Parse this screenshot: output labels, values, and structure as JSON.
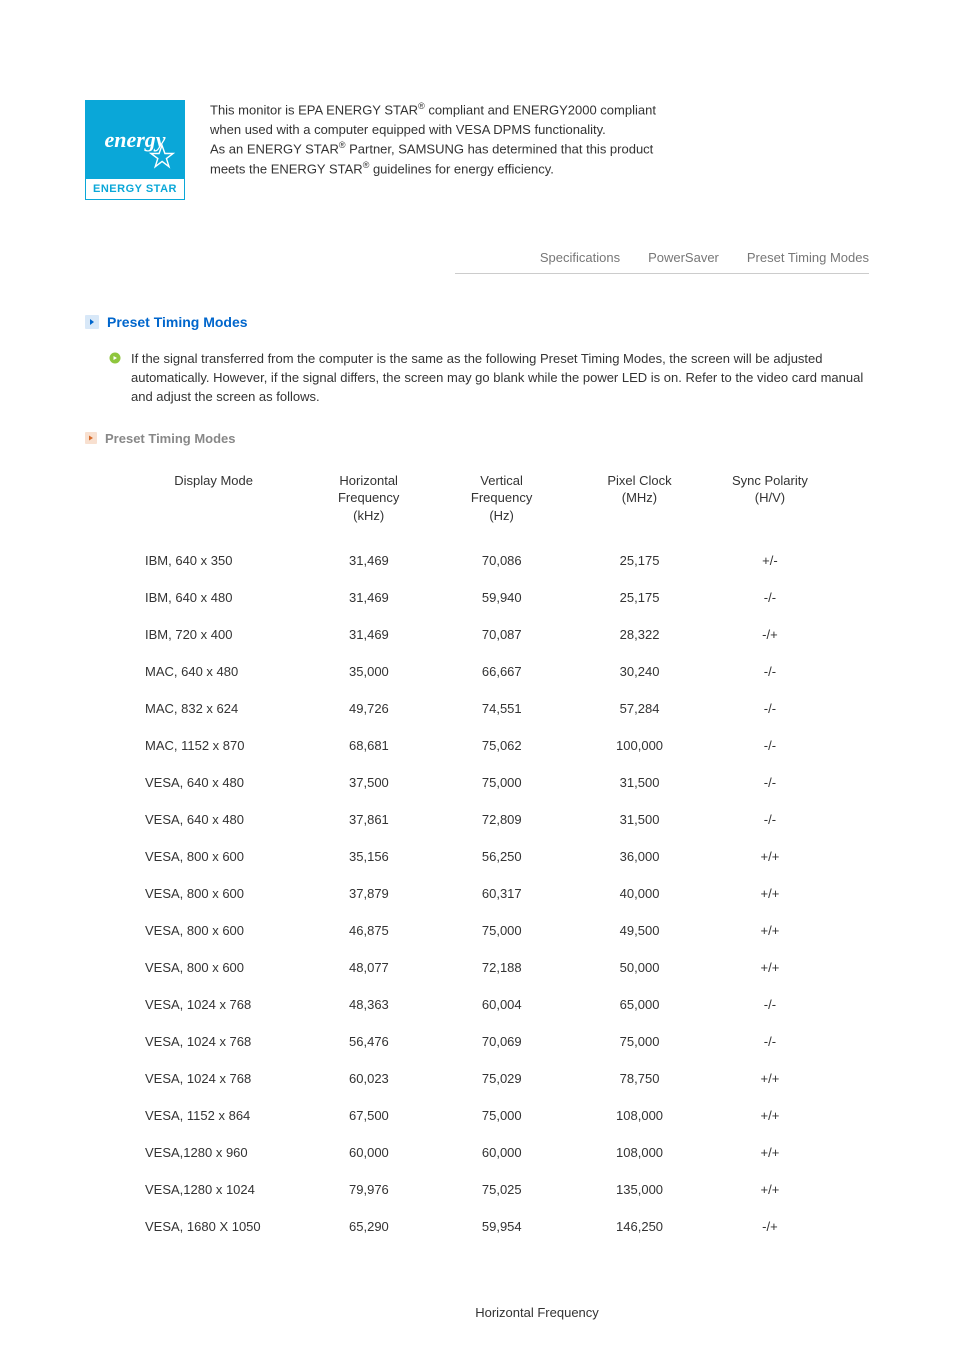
{
  "energyStar": {
    "logoScript": "energy",
    "logoBottom": "ENERGY STAR",
    "para1a": "This monitor is EPA ENERGY STAR",
    "para1b": " compliant and ENERGY2000 compliant when used with a computer equipped with VESA DPMS functionality.",
    "para2a": "As an ENERGY STAR",
    "para2b": " Partner, SAMSUNG has determined that this product meets the ENERGY STAR",
    "para2c": " guidelines for energy efficiency.",
    "reg": "®"
  },
  "tabs": {
    "specifications": "Specifications",
    "powersaver": "PowerSaver",
    "preset": "Preset Timing Modes"
  },
  "section": {
    "title": "Preset Timing Modes",
    "intro": "If the signal transferred from the computer is the same as the following Preset Timing Modes, the screen will be adjusted automatically. However, if the signal differs, the screen may go blank while the power LED is on. Refer to the video card manual and adjust the screen as follows.",
    "subsection": "Preset Timing Modes"
  },
  "table": {
    "headers": {
      "displayMode": "Display Mode",
      "horizontal": "Horizontal\nFrequency\n(kHz)",
      "vertical": "Vertical\nFrequency\n(Hz)",
      "pixelClock": "Pixel Clock\n(MHz)",
      "syncPolarity": "Sync Polarity\n(H/V)"
    },
    "rows": [
      {
        "mode": "IBM, 640 x 350",
        "h": "31,469",
        "v": "70,086",
        "p": "25,175",
        "s": "+/-"
      },
      {
        "mode": "IBM, 640 x 480",
        "h": "31,469",
        "v": "59,940",
        "p": "25,175",
        "s": "-/-"
      },
      {
        "mode": "IBM, 720 x 400",
        "h": "31,469",
        "v": "70,087",
        "p": "28,322",
        "s": "-/+"
      },
      {
        "mode": "MAC, 640 x 480",
        "h": "35,000",
        "v": "66,667",
        "p": "30,240",
        "s": "-/-"
      },
      {
        "mode": "MAC, 832 x 624",
        "h": "49,726",
        "v": "74,551",
        "p": "57,284",
        "s": "-/-"
      },
      {
        "mode": "MAC, 1152 x 870",
        "h": "68,681",
        "v": "75,062",
        "p": "100,000",
        "s": "-/-"
      },
      {
        "mode": "VESA, 640 x 480",
        "h": "37,500",
        "v": "75,000",
        "p": "31,500",
        "s": "-/-"
      },
      {
        "mode": "VESA, 640 x 480",
        "h": "37,861",
        "v": "72,809",
        "p": "31,500",
        "s": "-/-"
      },
      {
        "mode": "VESA, 800 x 600",
        "h": "35,156",
        "v": "56,250",
        "p": "36,000",
        "s": "+/+"
      },
      {
        "mode": "VESA, 800 x 600",
        "h": "37,879",
        "v": "60,317",
        "p": "40,000",
        "s": "+/+"
      },
      {
        "mode": "VESA, 800 x 600",
        "h": "46,875",
        "v": "75,000",
        "p": "49,500",
        "s": "+/+"
      },
      {
        "mode": "VESA, 800 x 600",
        "h": "48,077",
        "v": "72,188",
        "p": "50,000",
        "s": "+/+"
      },
      {
        "mode": "VESA, 1024 x 768",
        "h": "48,363",
        "v": "60,004",
        "p": "65,000",
        "s": "-/-"
      },
      {
        "mode": "VESA, 1024 x 768",
        "h": "56,476",
        "v": "70,069",
        "p": "75,000",
        "s": "-/-"
      },
      {
        "mode": "VESA, 1024 x 768",
        "h": "60,023",
        "v": "75,029",
        "p": "78,750",
        "s": "+/+"
      },
      {
        "mode": "VESA, 1152 x 864",
        "h": "67,500",
        "v": "75,000",
        "p": "108,000",
        "s": "+/+"
      },
      {
        "mode": "VESA,1280 x 960",
        "h": "60,000",
        "v": "60,000",
        "p": "108,000",
        "s": "+/+"
      },
      {
        "mode": "VESA,1280 x 1024",
        "h": "79,976",
        "v": "75,025",
        "p": "135,000",
        "s": "+/+"
      },
      {
        "mode": "VESA, 1680 X 1050",
        "h": "65,290",
        "v": "59,954",
        "p": "146,250",
        "s": "-/+"
      }
    ]
  },
  "footer": {
    "horizontalFreq": "Horizontal Frequency"
  }
}
